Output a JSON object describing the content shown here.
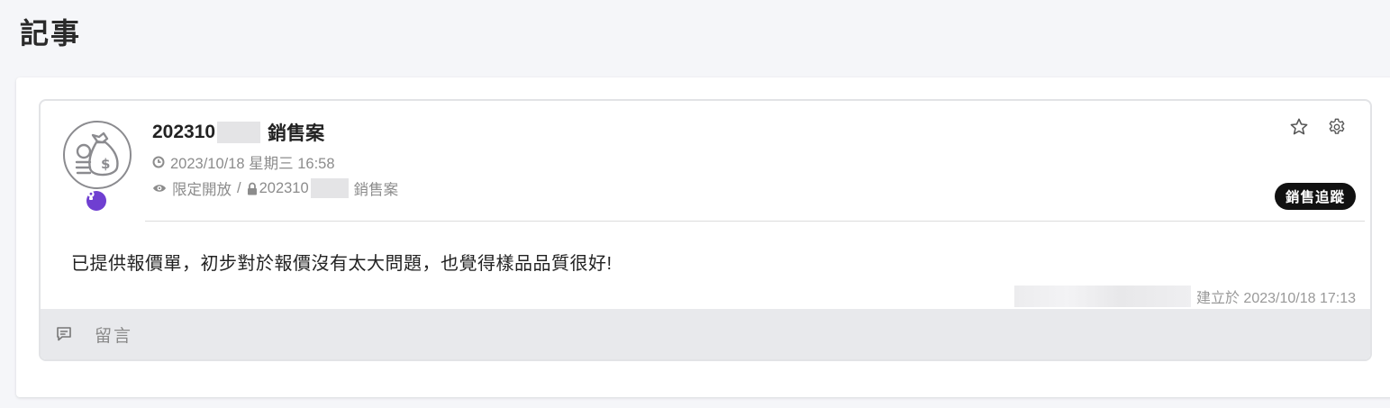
{
  "page": {
    "title": "記事"
  },
  "note": {
    "title_prefix": "202310",
    "title_suffix": "銷售案",
    "datetime": "2023/10/18 星期三 16:58",
    "visibility": "限定開放",
    "separator": "/",
    "related_prefix": "202310",
    "related_suffix": "銷售案",
    "tag": "銷售追蹤",
    "content": "已提供報價單，初步對於報價沒有太大問題，也覺得樣品品質很好!",
    "created_label": "建立於 2023/10/18 17:13",
    "comment_label": "留言"
  },
  "icons": {
    "avatar": "money-bag-icon",
    "badge": "lightbulb-icon",
    "time": "clock-icon",
    "visibility": "eye-icon",
    "lock": "lock-icon",
    "favorite": "star-icon",
    "settings": "gear-icon",
    "comment": "comment-icon"
  },
  "colors": {
    "accent_purple": "#6f3fd1",
    "tag_bg": "#111111",
    "comment_bar": "#e8e9ec"
  }
}
